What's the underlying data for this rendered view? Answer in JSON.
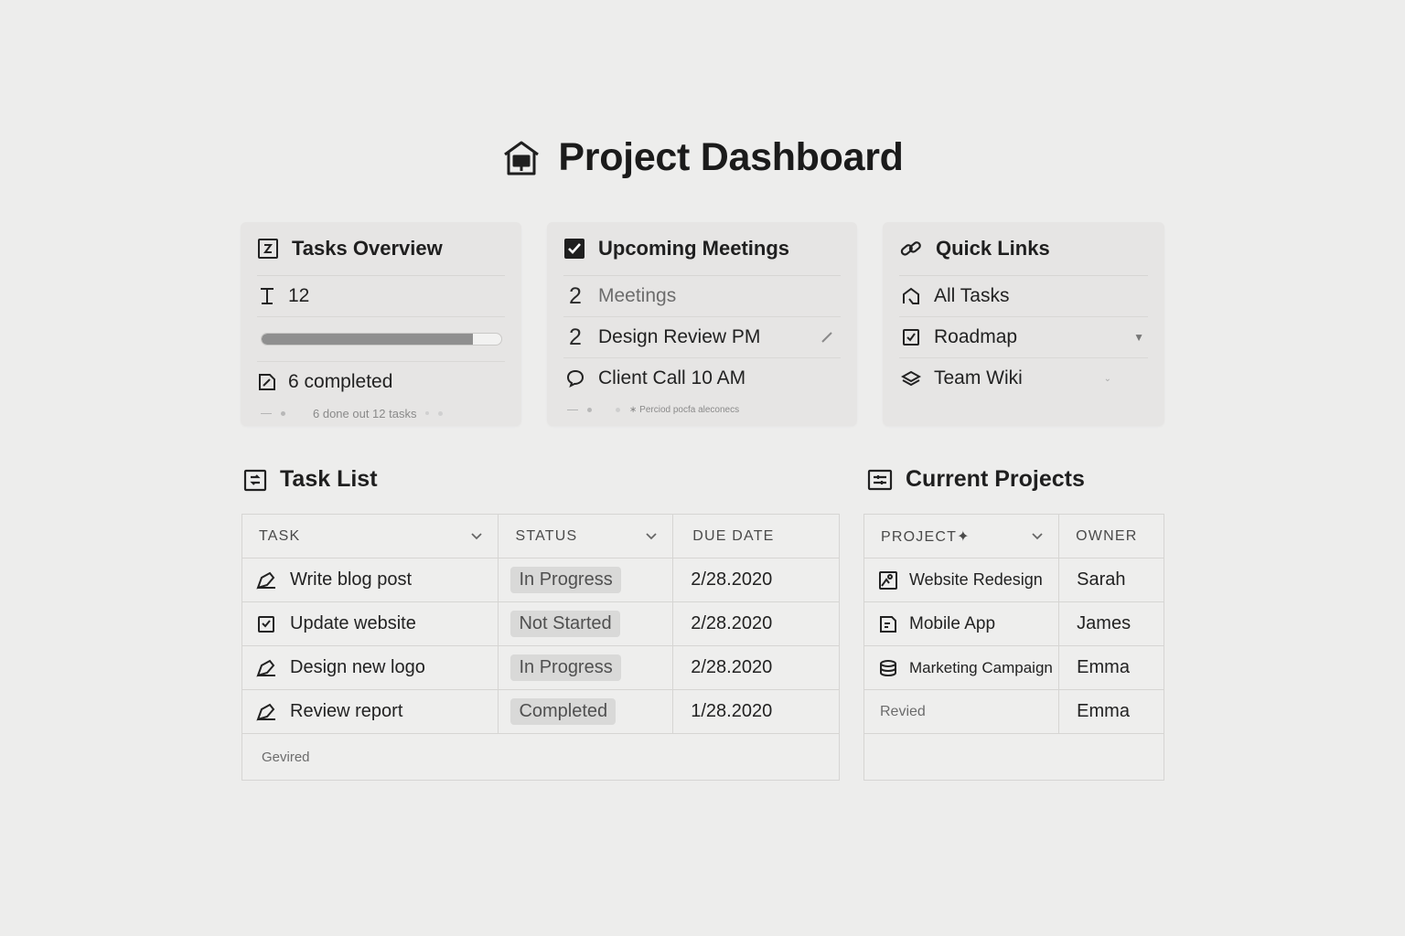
{
  "page": {
    "title": "Project Dashboard",
    "title_icon": "house-icon"
  },
  "cards": {
    "tasks_overview": {
      "title": "Tasks Overview",
      "count": "12",
      "progress": 0.88,
      "completed_label": "6 completed",
      "footnote": "6 done out 12 tasks"
    },
    "upcoming_meetings": {
      "title": "Upcoming Meetings",
      "items": [
        {
          "num": "2",
          "label": "Meetings"
        },
        {
          "num": "2",
          "label": "Design Review PM"
        },
        {
          "num": "",
          "label": "Client Call 10 AM"
        }
      ],
      "footnote": "∗ Perciod pocfa aleconecs"
    },
    "quick_links": {
      "title": "Quick Links",
      "items": [
        {
          "label": "All Tasks"
        },
        {
          "label": "Roadmap"
        },
        {
          "label": "Team Wiki"
        }
      ]
    }
  },
  "task_list": {
    "title": "Task List",
    "headers": {
      "task": "TASK",
      "status": "STATUS",
      "due": "DUE DATE"
    },
    "rows": [
      {
        "task": "Write blog post",
        "status": "In Progress",
        "due": "2/28.2020"
      },
      {
        "task": "Update website",
        "status": "Not Started",
        "due": "2/28.2020"
      },
      {
        "task": "Design new logo",
        "status": "In Progress",
        "due": "2/28.2020"
      },
      {
        "task": "Review report",
        "status": "Completed",
        "due": "1/28.2020"
      }
    ],
    "footer": "Gevired"
  },
  "current_projects": {
    "title": "Current Projects",
    "headers": {
      "project": "PROJECT✦",
      "owner": "OWNER"
    },
    "rows": [
      {
        "project": "Website Redesign",
        "owner": "Sarah"
      },
      {
        "project": "Mobile App",
        "owner": "James"
      },
      {
        "project": "Marketing Campaign",
        "owner": "Emma"
      },
      {
        "project": "Revied",
        "owner": "Emma"
      }
    ]
  },
  "colors": {
    "background": "#ededec",
    "card": "#e6e5e4",
    "badge": "#d9d9d8",
    "progress_fill": "#8f8f8f"
  }
}
